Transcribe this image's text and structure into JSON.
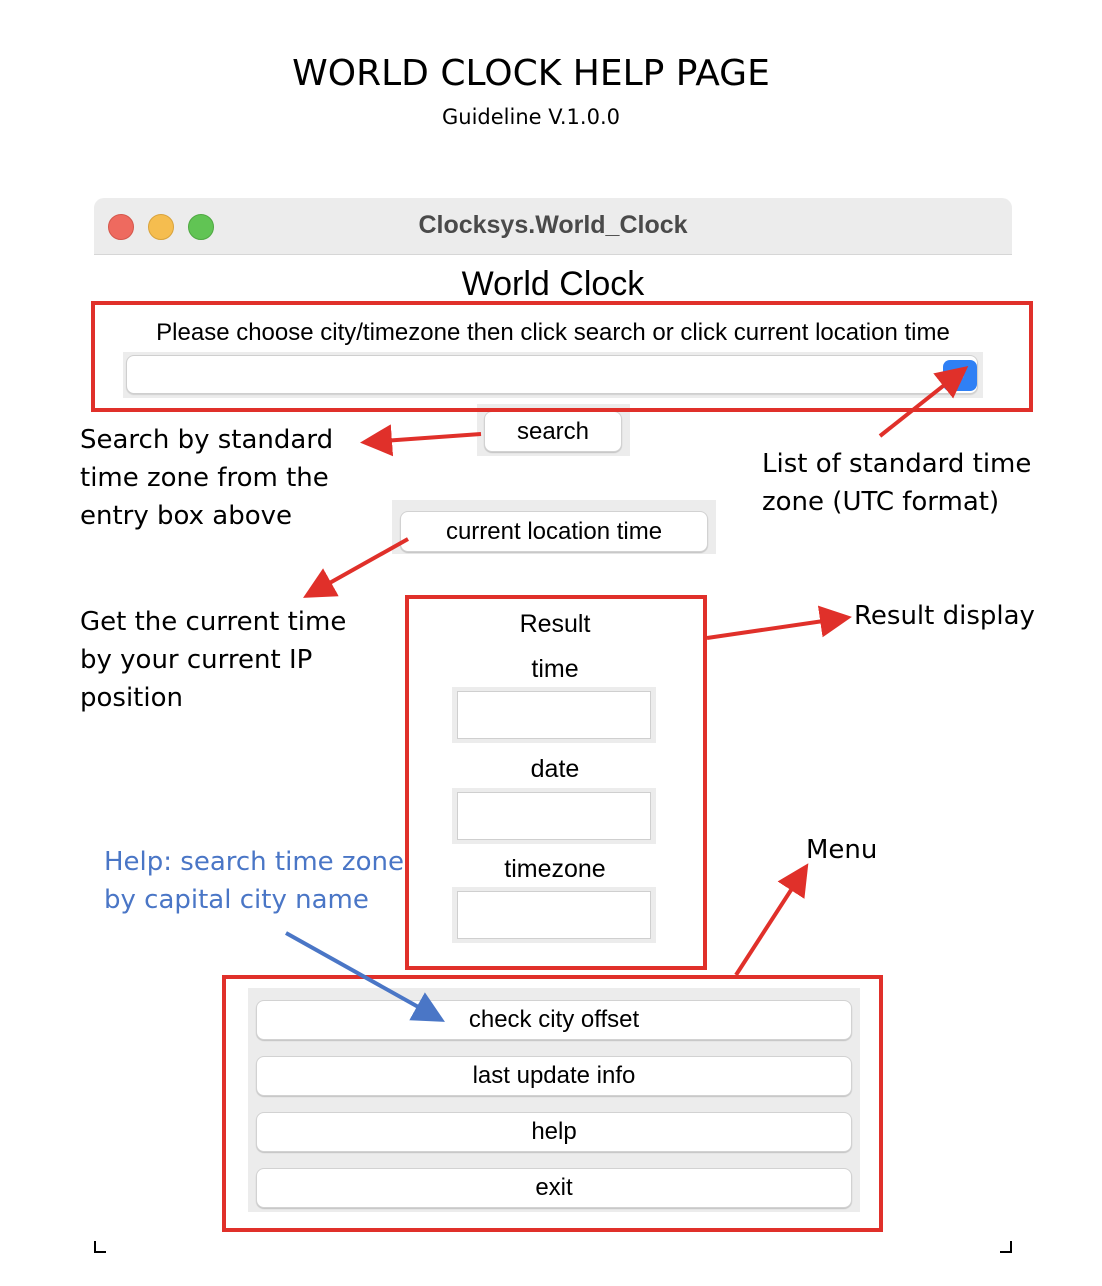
{
  "page": {
    "title": "WORLD CLOCK HELP PAGE",
    "subtitle": "Guideline V.1.0.0"
  },
  "window": {
    "title": "Clocksys.World_Clock",
    "heading": "World Clock",
    "instruction": "Please choose city/timezone then click search or click current location time",
    "combo_value": "",
    "combo_button_glyph": "⌄"
  },
  "buttons": {
    "search": "search",
    "current_location": "current location time"
  },
  "result": {
    "title": "Result",
    "time_label": "time",
    "time_value": "",
    "date_label": "date",
    "date_value": "",
    "timezone_label": "timezone",
    "timezone_value": ""
  },
  "menu": {
    "items": [
      {
        "label": "check city offset"
      },
      {
        "label": "last update info"
      },
      {
        "label": "help"
      },
      {
        "label": "exit"
      }
    ]
  },
  "annotations": {
    "search_note": [
      "Search by standard",
      "time zone from the",
      "entry box above"
    ],
    "list_note": [
      "List of standard time",
      "zone (UTC format)"
    ],
    "current_note": [
      "Get the current time",
      "by your current IP",
      "position"
    ],
    "result_note": "Result display",
    "menu_note": "Menu",
    "help_note": [
      "Help: search time zone",
      "by capital city name"
    ]
  },
  "colors": {
    "annotation_red": "#e0302a",
    "annotation_blue": "#4a76c6",
    "accent_blue": "#2f80f5"
  }
}
